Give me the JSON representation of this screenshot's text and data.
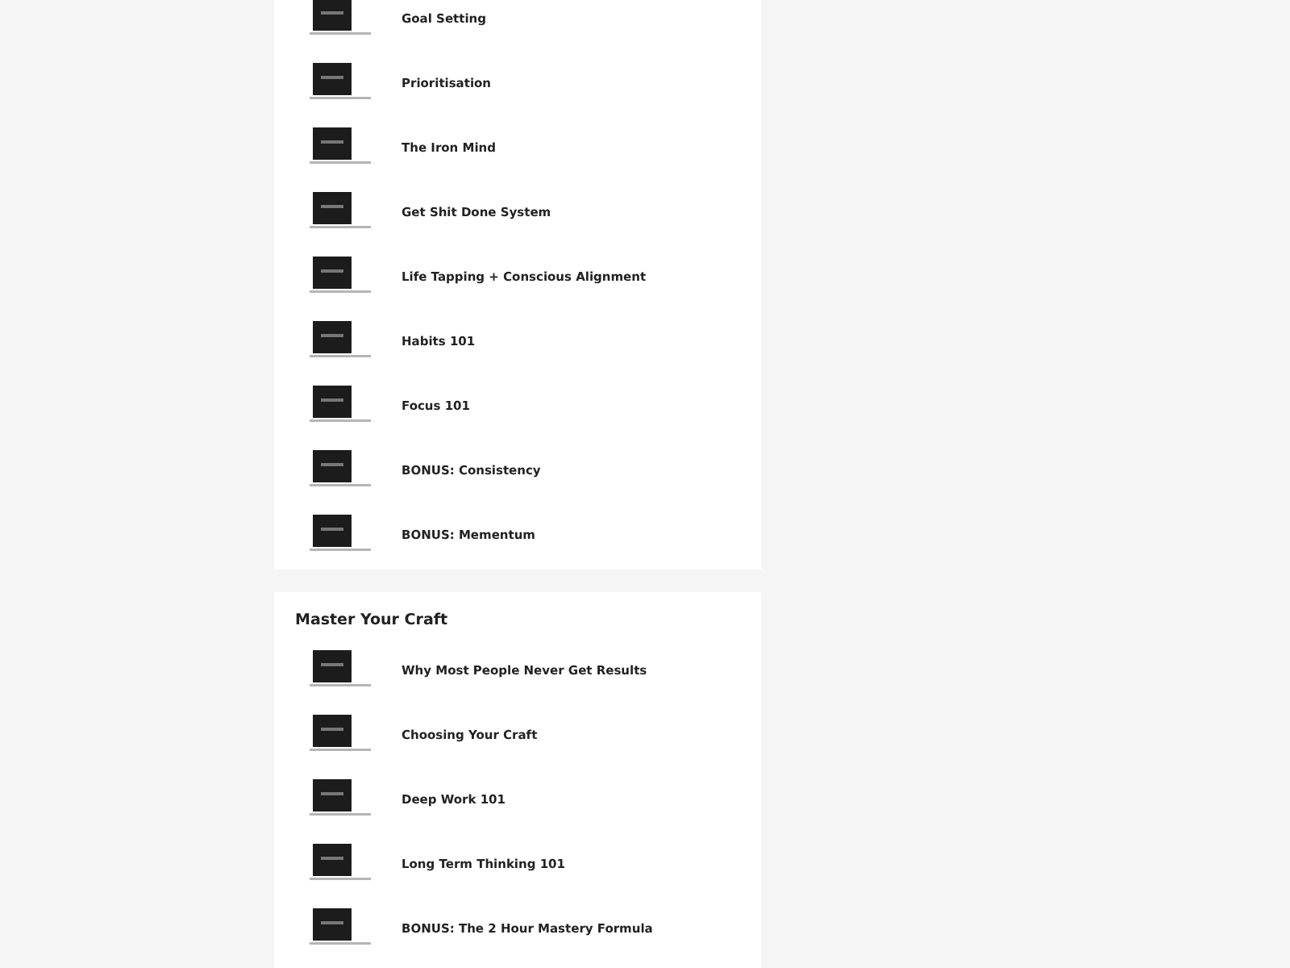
{
  "sections": [
    {
      "lessons": [
        {
          "title": "Goal Setting"
        },
        {
          "title": "Prioritisation"
        },
        {
          "title": "The Iron Mind"
        },
        {
          "title": "Get Shit Done System"
        },
        {
          "title": "Life Tapping + Conscious Alignment"
        },
        {
          "title": "Habits 101"
        },
        {
          "title": "Focus 101"
        },
        {
          "title": "BONUS: Consistency"
        },
        {
          "title": "BONUS: Mementum"
        }
      ]
    },
    {
      "title": "Master Your Craft",
      "lessons": [
        {
          "title": "Why Most People Never Get Results"
        },
        {
          "title": "Choosing Your Craft"
        },
        {
          "title": "Deep Work 101"
        },
        {
          "title": "Long Term Thinking 101"
        },
        {
          "title": "BONUS: The 2 Hour Mastery Formula"
        }
      ]
    }
  ]
}
